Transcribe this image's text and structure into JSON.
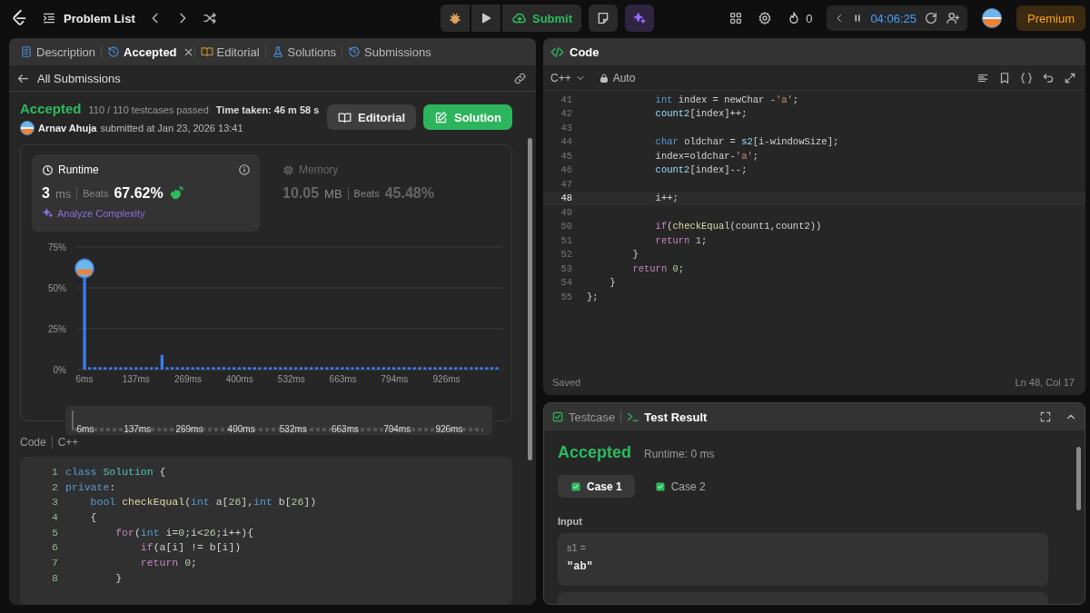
{
  "top_bar": {
    "title": "Problem List",
    "submit_label": "Submit",
    "streak": "0",
    "timer": "04:06:25",
    "premium": "Premium"
  },
  "left_panel": {
    "tabs": [
      {
        "label": "Description",
        "kind": "description",
        "selected": false,
        "closable": false
      },
      {
        "label": "Accepted",
        "kind": "history",
        "selected": true,
        "closable": true
      },
      {
        "label": "Editorial",
        "kind": "editorial",
        "selected": false,
        "closable": false
      },
      {
        "label": "Solutions",
        "kind": "solutions",
        "selected": false,
        "closable": false
      },
      {
        "label": "Submissions",
        "kind": "history",
        "selected": false,
        "closable": false
      }
    ],
    "back_label": "All Submissions",
    "submission": {
      "status": "Accepted",
      "testcases": "110 / 110 testcases passed",
      "time_taken": "Time taken: 46 m 58 s",
      "author": "Arnav Ahuja",
      "submitted": "submitted at Jan 23, 2026 13:41"
    },
    "buttons": [
      {
        "label": "Editorial",
        "kind": "secondary"
      },
      {
        "label": "Solution",
        "kind": "primary"
      }
    ],
    "metrics": [
      {
        "kind": "runtime",
        "title": "Runtime",
        "value": "3",
        "unit": "ms",
        "beats_label": "Beats",
        "beats": "67.62%",
        "selected": true,
        "action": "Analyze Complexity"
      },
      {
        "kind": "memory",
        "title": "Memory",
        "value": "10.05",
        "unit": "MB",
        "beats_label": "Beats",
        "beats": "45.48%",
        "selected": false
      }
    ],
    "chart_data": {
      "type": "bar",
      "x": [
        6,
        19,
        32,
        45,
        58,
        72,
        85,
        98,
        111,
        124,
        137,
        150,
        163,
        176,
        189,
        203,
        216,
        229,
        242,
        255,
        268,
        281,
        294,
        307,
        320,
        334,
        347,
        360,
        373,
        386,
        399,
        412,
        425,
        438,
        451,
        465,
        478,
        491,
        504,
        517,
        530,
        543,
        556,
        569,
        582,
        596,
        609,
        622,
        635,
        648,
        661,
        674,
        687,
        700,
        713,
        727,
        740,
        753,
        766,
        779,
        792,
        805,
        818,
        831,
        844,
        858,
        871,
        884,
        897,
        910,
        923,
        936,
        949,
        962,
        975,
        989,
        1002,
        1015,
        1028,
        1041,
        1054
      ],
      "values": [
        68,
        1.5,
        1.5,
        1.5,
        1.5,
        1.5,
        1.5,
        1.5,
        1.5,
        1.5,
        1.5,
        1.5,
        1.5,
        1.5,
        1.5,
        9,
        1.5,
        1.5,
        1.5,
        1.5,
        1.5,
        1.5,
        1.5,
        1.5,
        1.5,
        1.5,
        1.5,
        1.5,
        1.5,
        1.5,
        1.5,
        1.5,
        1.5,
        1.5,
        1.5,
        1.5,
        1.5,
        1.5,
        1.5,
        1.5,
        1.5,
        1.5,
        1.5,
        1.5,
        1.5,
        1.5,
        1.5,
        1.5,
        1.5,
        1.5,
        1.5,
        1.5,
        1.5,
        1.5,
        1.5,
        1.5,
        1.5,
        1.5,
        1.5,
        1.5,
        1.5,
        1.5,
        1.5,
        1.5,
        1.5,
        1.5,
        1.5,
        1.5,
        1.5,
        1.5,
        1.5,
        1.5,
        1.5,
        1.5,
        1.5,
        1.5,
        1.5,
        1.5,
        1.5,
        1.5,
        1.5
      ],
      "xlim": [
        6,
        1054
      ],
      "ylim": [
        0,
        75
      ],
      "xticks": [
        {
          "value": 6,
          "label": "6ms"
        },
        {
          "value": 137,
          "label": "137ms"
        },
        {
          "value": 269,
          "label": "269ms"
        },
        {
          "value": 400,
          "label": "400ms"
        },
        {
          "value": 532,
          "label": "532ms"
        },
        {
          "value": 663,
          "label": "663ms"
        },
        {
          "value": 794,
          "label": "794ms"
        },
        {
          "value": 926,
          "label": "926ms"
        }
      ],
      "yticks": [
        {
          "value": 0,
          "label": "0%"
        },
        {
          "value": 25,
          "label": "25%"
        },
        {
          "value": 50,
          "label": "50%"
        },
        {
          "value": 75,
          "label": "75%"
        }
      ]
    },
    "overview_labels": [
      "6ms",
      "137ms",
      "269ms",
      "400ms",
      "532ms",
      "663ms",
      "794ms",
      "926ms"
    ],
    "code_header": {
      "title": "Code",
      "language": "C++"
    },
    "code_lines": [
      {
        "num": "1",
        "segs": [
          {
            "kind": "keyword",
            "text": "class "
          },
          {
            "kind": "type",
            "text": "Solution"
          },
          {
            "kind": "plain",
            "text": " {"
          }
        ]
      },
      {
        "num": "2",
        "segs": [
          {
            "kind": "keyword",
            "text": "private"
          },
          {
            "kind": "plain",
            "text": ":"
          }
        ]
      },
      {
        "num": "3",
        "segs": [
          {
            "kind": "keyword",
            "text": "    bool "
          },
          {
            "kind": "func",
            "text": "checkEqual"
          },
          {
            "kind": "plain",
            "text": "("
          },
          {
            "kind": "keyword",
            "text": "int"
          },
          {
            "kind": "plain",
            "text": " a["
          },
          {
            "kind": "num",
            "text": "26"
          },
          {
            "kind": "plain",
            "text": "],"
          },
          {
            "kind": "keyword",
            "text": "int"
          },
          {
            "kind": "plain",
            "text": " b["
          },
          {
            "kind": "num",
            "text": "26"
          },
          {
            "kind": "plain",
            "text": "])"
          }
        ]
      },
      {
        "num": "4",
        "segs": [
          {
            "kind": "plain",
            "text": "    {"
          }
        ]
      },
      {
        "num": "5",
        "segs": [
          {
            "kind": "ctrl",
            "text": "        for"
          },
          {
            "kind": "plain",
            "text": "("
          },
          {
            "kind": "keyword",
            "text": "int"
          },
          {
            "kind": "plain",
            "text": " i="
          },
          {
            "kind": "num",
            "text": "0"
          },
          {
            "kind": "plain",
            "text": ";i<"
          },
          {
            "kind": "num",
            "text": "26"
          },
          {
            "kind": "plain",
            "text": ";i++){"
          }
        ]
      },
      {
        "num": "6",
        "segs": [
          {
            "kind": "ctrl",
            "text": "            if"
          },
          {
            "kind": "plain",
            "text": "(a[i] != b[i])"
          }
        ]
      },
      {
        "num": "7",
        "segs": [
          {
            "kind": "ctrl",
            "text": "            return "
          },
          {
            "kind": "num",
            "text": "0"
          },
          {
            "kind": "plain",
            "text": ";"
          }
        ]
      },
      {
        "num": "8",
        "segs": [
          {
            "kind": "plain",
            "text": "        }"
          }
        ]
      }
    ]
  },
  "editor": {
    "title": "Code",
    "language": "C++",
    "mode": "Auto",
    "lines": [
      {
        "num": "41",
        "current": false,
        "segs": [
          {
            "kind": "keyword",
            "text": "            int"
          },
          {
            "kind": "plain",
            "text": " index = newChar -"
          },
          {
            "kind": "str",
            "text": "'a'"
          },
          {
            "kind": "plain",
            "text": ";"
          }
        ]
      },
      {
        "num": "42",
        "current": false,
        "segs": [
          {
            "kind": "var",
            "text": "            count2"
          },
          {
            "kind": "plain",
            "text": "[index]++;"
          }
        ]
      },
      {
        "num": "43",
        "current": false
      },
      {
        "num": "44",
        "current": false,
        "segs": [
          {
            "kind": "keyword",
            "text": "            char"
          },
          {
            "kind": "plain",
            "text": " oldchar = "
          },
          {
            "kind": "var",
            "text": "s2"
          },
          {
            "kind": "plain",
            "text": "[i-windowSize];"
          }
        ]
      },
      {
        "num": "45",
        "current": false,
        "segs": [
          {
            "kind": "plain",
            "text": "            index=oldchar-"
          },
          {
            "kind": "str",
            "text": "'a'"
          },
          {
            "kind": "plain",
            "text": ";"
          }
        ]
      },
      {
        "num": "46",
        "current": false,
        "segs": [
          {
            "kind": "var",
            "text": "            count2"
          },
          {
            "kind": "plain",
            "text": "[index]--;"
          }
        ]
      },
      {
        "num": "47",
        "current": false
      },
      {
        "num": "48",
        "current": true,
        "segs": [
          {
            "kind": "plain",
            "text": "            i++;"
          }
        ]
      },
      {
        "num": "49",
        "current": false
      },
      {
        "num": "50",
        "current": false,
        "segs": [
          {
            "kind": "ctrl",
            "text": "            if"
          },
          {
            "kind": "plain",
            "text": "("
          },
          {
            "kind": "func",
            "text": "checkEqual"
          },
          {
            "kind": "plain",
            "text": "(count1,count2))"
          }
        ]
      },
      {
        "num": "51",
        "current": false,
        "segs": [
          {
            "kind": "ctrl",
            "text": "            return "
          },
          {
            "kind": "num",
            "text": "1"
          },
          {
            "kind": "plain",
            "text": ";"
          }
        ]
      },
      {
        "num": "52",
        "current": false,
        "segs": [
          {
            "kind": "plain",
            "text": "        }"
          }
        ]
      },
      {
        "num": "53",
        "current": false,
        "segs": [
          {
            "kind": "ctrl",
            "text": "        return "
          },
          {
            "kind": "num",
            "text": "0"
          },
          {
            "kind": "plain",
            "text": ";"
          }
        ]
      },
      {
        "num": "54",
        "current": false,
        "segs": [
          {
            "kind": "plain",
            "text": "    }"
          }
        ]
      },
      {
        "num": "55",
        "current": false,
        "segs": [
          {
            "kind": "plain",
            "text": "};"
          }
        ]
      }
    ],
    "status": "Saved",
    "cursor": "Ln 48, Col 17"
  },
  "result_panel": {
    "tabs": [
      {
        "label": "Testcase",
        "kind": "testcase",
        "selected": false
      },
      {
        "label": "Test Result",
        "kind": "terminal",
        "selected": true
      }
    ],
    "status": "Accepted",
    "runtime": "Runtime: 0 ms",
    "cases": [
      {
        "label": "Case 1",
        "selected": true,
        "passed": true
      },
      {
        "label": "Case 2",
        "selected": false,
        "passed": true
      }
    ],
    "input_label": "Input",
    "inputs": [
      {
        "name": "s1 =",
        "value": "\"ab\""
      }
    ]
  }
}
